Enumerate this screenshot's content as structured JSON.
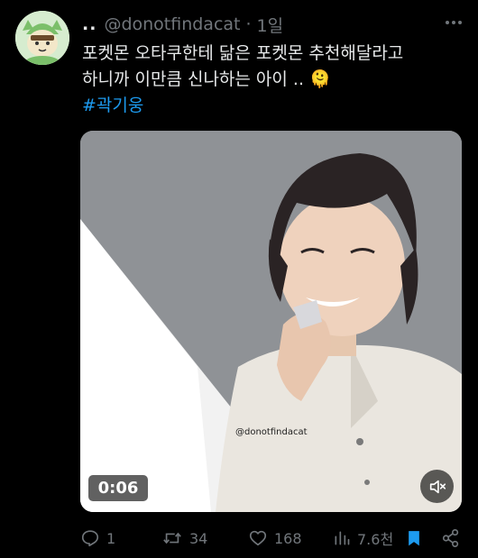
{
  "tweet": {
    "author_name": "..",
    "handle": "@donotfindacat",
    "separator": "·",
    "time": "1일",
    "text_lines": [
      "포켓몬 오타쿠한테 닮은 포켓몬 추천해달라고",
      "하니까 이만큼 신나하는 아이 .. 🫠"
    ],
    "hashtag": "#곽기웅"
  },
  "media": {
    "watermark": "@donotfindacat",
    "timer": "0:06",
    "mute_icon": "speaker-muted-icon"
  },
  "actions": {
    "replies": "1",
    "retweets": "34",
    "likes": "168",
    "views": "7.6천"
  },
  "colors": {
    "background": "#000000",
    "text": "#e7e9ea",
    "secondary": "#71767b",
    "accent": "#1d9bf0"
  }
}
